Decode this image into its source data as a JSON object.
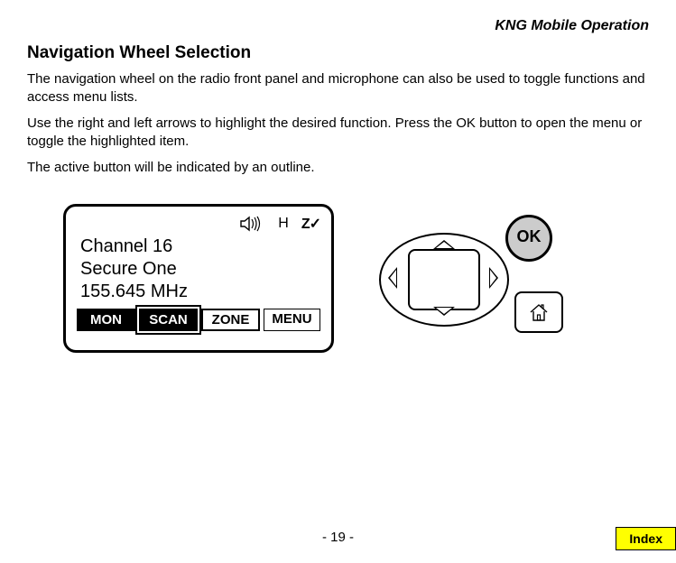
{
  "header": {
    "title": "KNG Mobile Operation"
  },
  "section": {
    "heading": "Navigation Wheel Selection",
    "p1": "The navigation wheel on the radio front panel and microphone can also be used to toggle functions and access menu lists.",
    "p2": "Use the right and left arrows to highlight the desired function. Press the OK button to open the menu or toggle the highlighted item.",
    "p3": "The active button will be indicated by an outline."
  },
  "radio": {
    "status": {
      "h": "H",
      "z": "Z✓"
    },
    "line1": "Channel 16",
    "line2": "Secure One",
    "line3": "155.645 MHz",
    "softkeys": {
      "mon": "MON",
      "scan": "SCAN",
      "zone": "ZONE",
      "menu": "MENU"
    }
  },
  "controls": {
    "ok": "OK"
  },
  "footer": {
    "page": "- 19 -",
    "index": "Index"
  }
}
